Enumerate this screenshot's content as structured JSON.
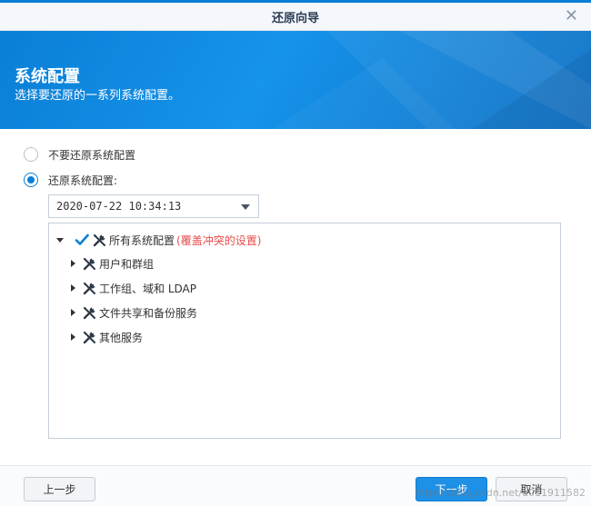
{
  "window": {
    "title": "还原向导"
  },
  "banner": {
    "title": "系统配置",
    "subtitle": "选择要还原的一系列系统配置。"
  },
  "options": {
    "no_restore": "不要还原系统配置",
    "restore": "还原系统配置:"
  },
  "select": {
    "value": "2020-07-22 10:34:13"
  },
  "tree": {
    "root_label": "所有系统配置",
    "root_note": "(覆盖冲突的设置)",
    "children": [
      "用户和群组",
      "工作组、域和 LDAP",
      "文件共享和备份服务",
      "其他服务"
    ]
  },
  "footer": {
    "prev": "上一步",
    "next": "下一步",
    "cancel": "取消"
  },
  "watermark": "https://blog.csdn.net/u011911582",
  "colors": {
    "accent": "#0a7fd6",
    "warning": "#e84a4a"
  }
}
